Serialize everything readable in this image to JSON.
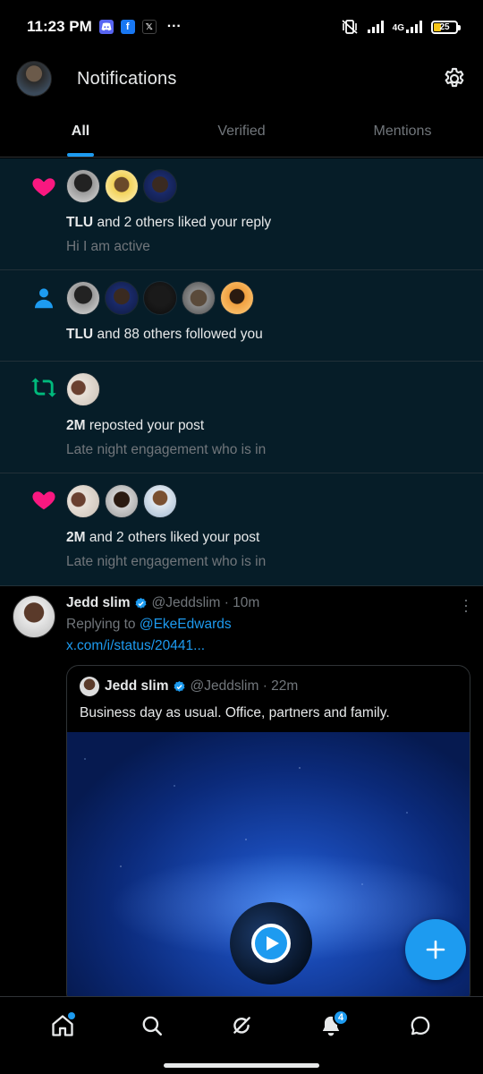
{
  "status_bar": {
    "time": "11:23 PM",
    "network": "4G",
    "battery": "25",
    "apps": [
      "discord-icon",
      "facebook-icon",
      "x-icon"
    ],
    "more": "···"
  },
  "header": {
    "title": "Notifications"
  },
  "tabs": [
    {
      "label": "All"
    },
    {
      "label": "Verified"
    },
    {
      "label": "Mentions"
    }
  ],
  "notifications": [
    {
      "icon": "heart-icon",
      "bold": "TLU",
      "text": " and 2 others liked your reply",
      "sub": "Hi I am active"
    },
    {
      "icon": "person-icon",
      "bold": "TLU",
      "text": " and 88 others followed you",
      "sub": ""
    },
    {
      "icon": "repost-icon",
      "bold": "2M",
      "text": " reposted your post",
      "sub": "Late night engagement who is in"
    },
    {
      "icon": "heart-icon",
      "bold": "2M",
      "text": " and 2 others liked your post",
      "sub": "Late night engagement who is in"
    }
  ],
  "tweet": {
    "name": "Jedd slim",
    "handle": "@Jeddslim · 10m",
    "replying_prefix": "Replying to ",
    "replying_to": "@EkeEdwards",
    "link": "x.com/i/status/20441...",
    "quote": {
      "name": "Jedd slim",
      "handle": "@Jeddslim · 22m",
      "text": "Business day as usual. Office, partners and family."
    }
  },
  "bottom_nav": {
    "notification_badge": "4"
  },
  "colors": {
    "accent": "#1d9bf0",
    "heart": "#f91880",
    "repost": "#00ba7c",
    "notif_bg": "#061d28"
  }
}
